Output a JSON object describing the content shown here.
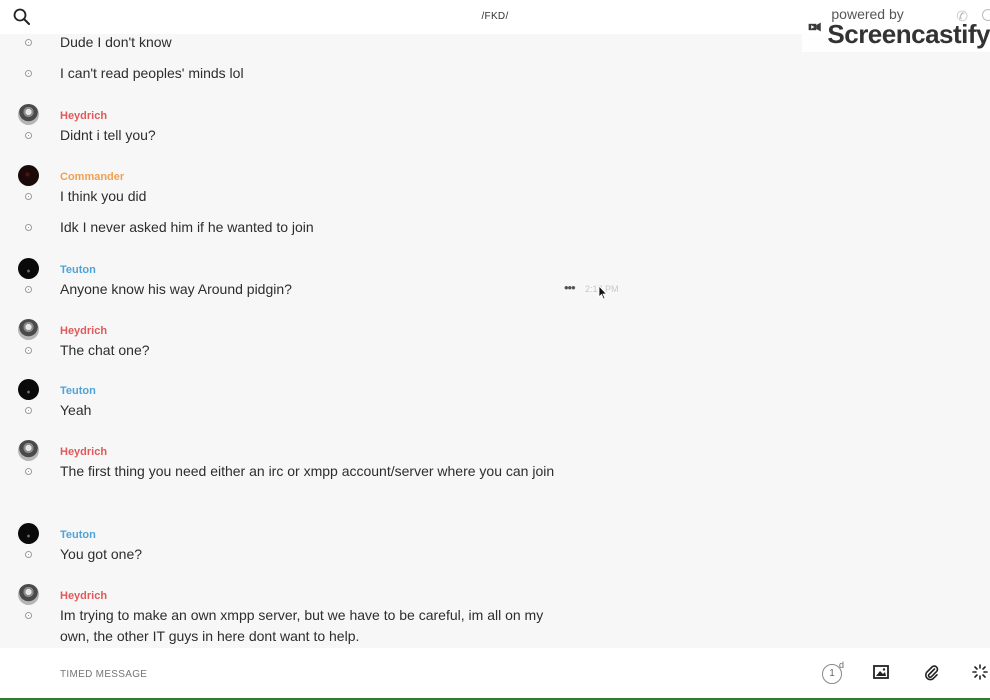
{
  "header": {
    "room_title": "/FKD/"
  },
  "watermark": {
    "powered_by": "powered by",
    "brand": "Screencastify"
  },
  "colors": {
    "heydrich": "#e05a5a",
    "commander": "#f0a050",
    "teuton": "#4fa3d8"
  },
  "messages": [
    {
      "sender": null,
      "text": "Dude I don't know"
    },
    {
      "sender": null,
      "text": "I can't read peoples' minds lol"
    },
    {
      "sender": "Heydrich",
      "text": "Didnt i tell you?"
    },
    {
      "sender": "Commander",
      "text": "I think you did"
    },
    {
      "sender": null,
      "text": "Idk I never asked him if he wanted to join"
    },
    {
      "sender": "Teuton",
      "text": "Anyone know his way Around pidgin?",
      "time": "2:17 PM"
    },
    {
      "sender": "Heydrich",
      "text": "The chat one?"
    },
    {
      "sender": "Teuton",
      "text": "Yeah"
    },
    {
      "sender": "Heydrich",
      "text": "The first thing you need either an irc or xmpp account/server where you can join"
    },
    {
      "sender": "Teuton",
      "text": "You got one?"
    },
    {
      "sender": "Heydrich",
      "text": "Im trying to make an own xmpp server, but we have to be careful, im all on my own, the other IT guys in here dont want to help."
    }
  ],
  "composer": {
    "placeholder": "TIMED MESSAGE",
    "timer_value": "1",
    "timer_unit": "d"
  }
}
